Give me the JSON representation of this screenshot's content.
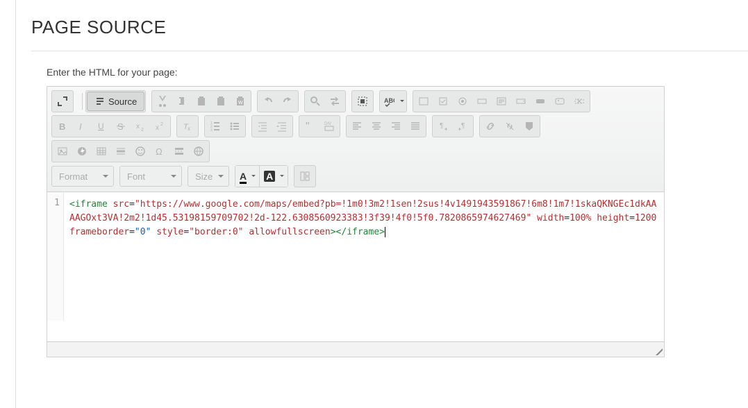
{
  "page": {
    "title": "PAGE SOURCE",
    "field_label": "Enter the HTML for your page:"
  },
  "toolbar": {
    "source_label": "Source",
    "format_label": "Format",
    "font_label": "Font",
    "size_label": "Size"
  },
  "code": {
    "line_number": "1",
    "t_open": "<iframe",
    "a_src": "src",
    "v_src": "\"https://www.google.com/maps/embed?pb=!1m0!3m2!1sen!2sus!4v1491943591867!6m8!1m7!1skaQKNGEc1dkAAAAGOxt3VA!2m2!1d45.53198159709702!2d-122.6308560923383!3f39!4f0!5f0.7820865974627469\"",
    "a_width": "width",
    "v_width": "100%",
    "a_height": "height",
    "v_height": "1200",
    "a_fb": "frameborder",
    "v_fb": "\"0\"",
    "a_style": "style",
    "v_style": "\"border:0\"",
    "a_afs": "allowfullscreen",
    "t_close": "></iframe>"
  }
}
